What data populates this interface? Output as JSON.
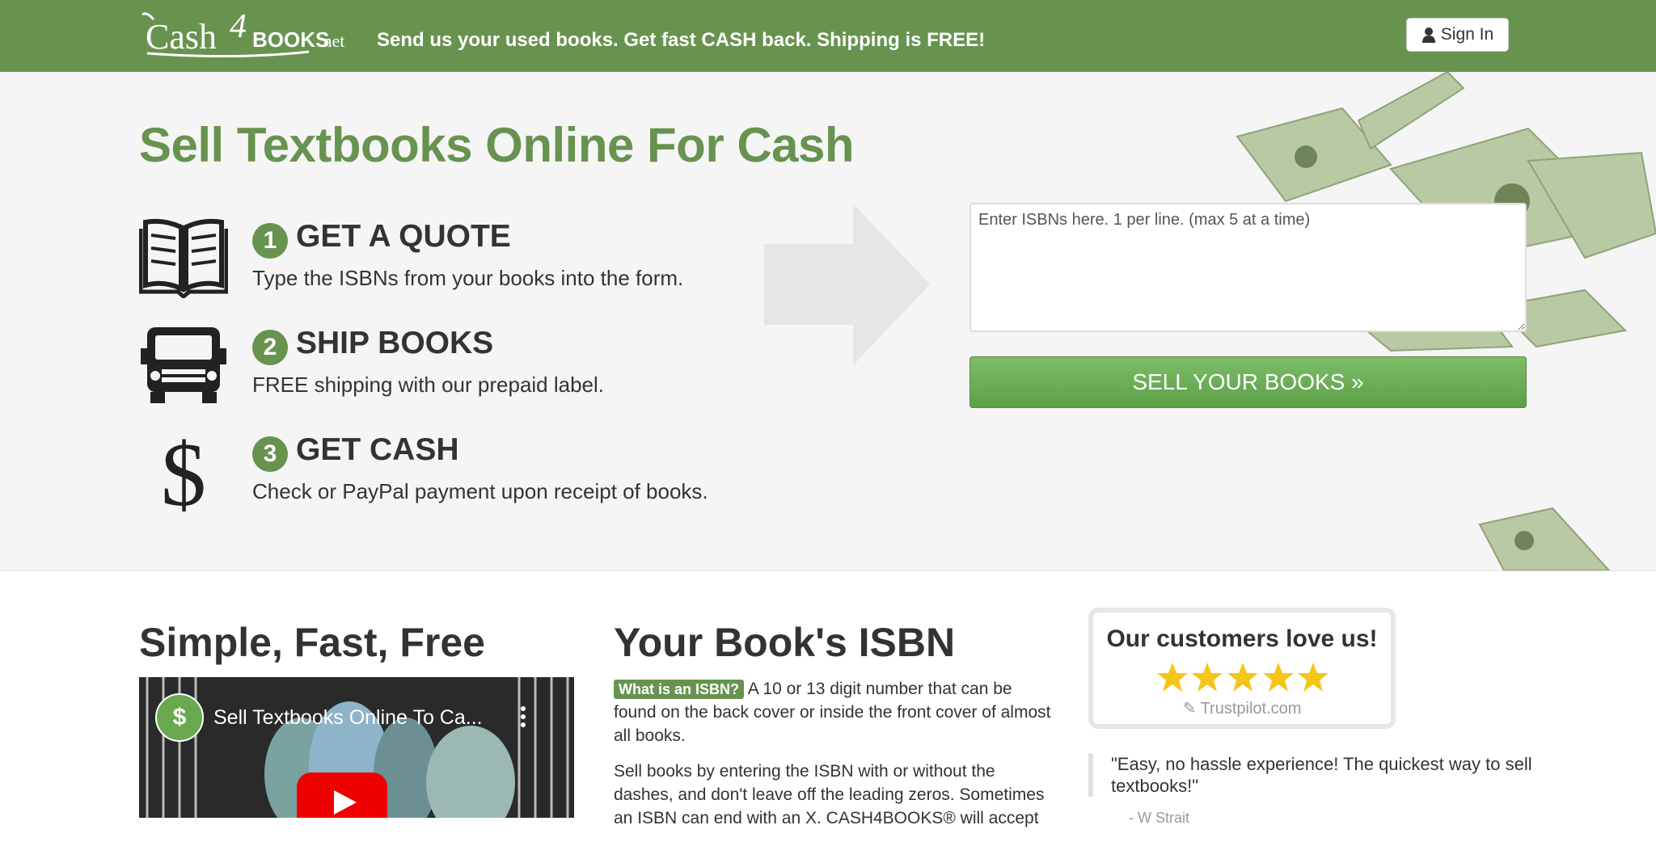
{
  "header": {
    "logo_text": "Cash4BOOKS.net",
    "tagline": "Send us your used books. Get fast CASH back. Shipping is FREE!",
    "sign_in_label": "Sign In"
  },
  "hero": {
    "title": "Sell Textbooks Online For Cash",
    "steps": [
      {
        "number": "1",
        "heading": "GET A QUOTE",
        "text": "Type the ISBNs from your books into the form.",
        "icon": "open-book-icon"
      },
      {
        "number": "2",
        "heading": "SHIP BOOKS",
        "text": "FREE shipping with our prepaid label.",
        "icon": "truck-icon"
      },
      {
        "number": "3",
        "heading": "GET CASH",
        "text": "Check or PayPal payment upon receipt of books.",
        "icon": "dollar-sign-icon"
      }
    ],
    "isbn_input": {
      "placeholder": "Enter ISBNs here. 1 per line. (max 5 at a time)",
      "value": ""
    },
    "sell_button_label": "SELL YOUR BOOKS »"
  },
  "video_section": {
    "title": "Simple, Fast, Free",
    "video_title": "Sell Textbooks Online To Ca..."
  },
  "isbn_section": {
    "title": "Your Book's ISBN",
    "badge": "What is an ISBN?",
    "p1": "A 10 or 13 digit number that can be found on the back cover or inside the front cover of almost all books.",
    "p2": "Sell books by entering the ISBN with or without the dashes, and don't leave off the leading zeros. Sometimes an ISBN can end with an X. CASH4BOOKS® will accept"
  },
  "reviews": {
    "title": "Our customers love us!",
    "rating": 5,
    "source": "Trustpilot.com",
    "quote": "\"Easy, no hassle experience! The quickest way to sell textbooks!\"",
    "author": "- W Strait"
  },
  "colors": {
    "brand_green": "#67934f",
    "button_green": "#5ca047",
    "star_yellow": "#f5c518"
  }
}
